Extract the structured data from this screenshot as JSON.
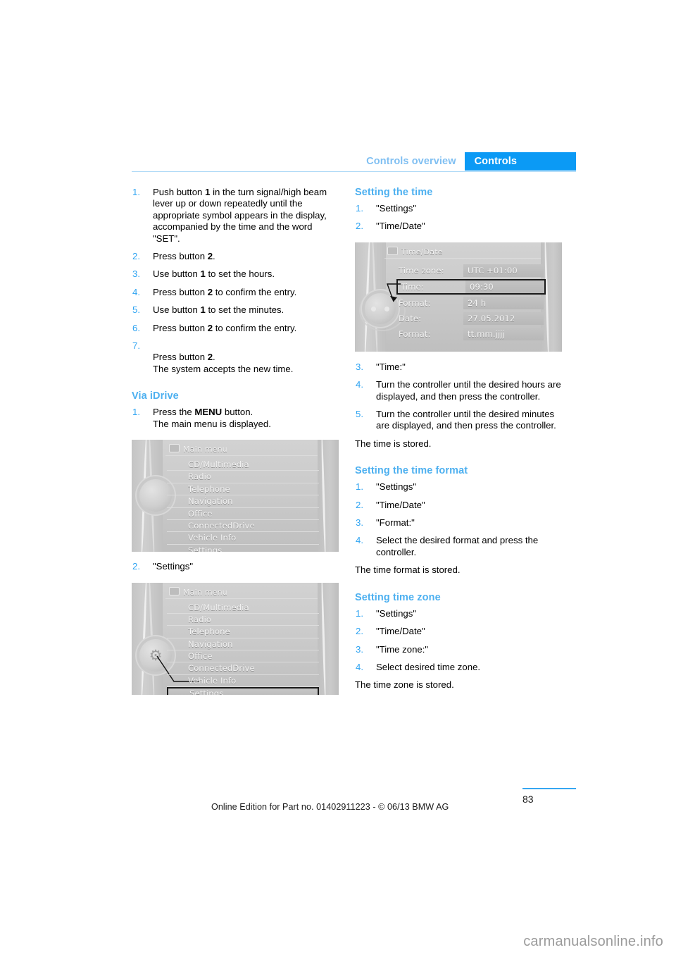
{
  "header": {
    "tab_inactive": "Controls overview",
    "tab_active": "Controls",
    "accent_color": "#0b9af5",
    "inactive_color": "#7fbff2"
  },
  "left_column": {
    "steps_top": [
      {
        "num": "1.",
        "text_pre": "Push button ",
        "bold": "1",
        "text_post": " in the turn signal/high beam lever up or down repeatedly until the appropriate symbol appears in the display, accompanied by the time and the word \"SET\"."
      },
      {
        "num": "2.",
        "text_pre": "Press button ",
        "bold": "2",
        "text_post": "."
      },
      {
        "num": "3.",
        "text_pre": "Use button ",
        "bold": "1",
        "text_post": " to set the hours."
      },
      {
        "num": "4.",
        "text_pre": "Press button ",
        "bold": "2",
        "text_post": " to confirm the entry."
      },
      {
        "num": "5.",
        "text_pre": "Use button ",
        "bold": "1",
        "text_post": " to set the minutes."
      },
      {
        "num": "6.",
        "text_pre": "Press button ",
        "bold": "2",
        "text_post": " to confirm the entry."
      },
      {
        "num": "7.",
        "text_pre": "Press button ",
        "bold": "2",
        "text_post": ".\nThe system accepts the new time."
      }
    ],
    "via_idrive_title": "Via iDrive",
    "step1_num": "1.",
    "step1_pre": "Press the ",
    "step1_bold": "MENU",
    "step1_post": " button.",
    "step1_line2": "The main menu is displayed.",
    "step2_num": "2.",
    "step2_text": "\"Settings\""
  },
  "idrive_main_menu": {
    "title": "Main menu",
    "items": [
      "CD/Multimedia",
      "Radio",
      "Telephone",
      "Navigation",
      "Office",
      "ConnectedDrive",
      "Vehicle Info",
      "Settings"
    ],
    "selected": "Settings"
  },
  "idrive_time_date": {
    "title": "Time/Date",
    "rows": [
      {
        "label": "Time zone:",
        "value": "UTC +01:00",
        "highlighted": false
      },
      {
        "label": "Time:",
        "value": "09:30",
        "highlighted": true
      },
      {
        "label": "Format:",
        "value": "24 h",
        "highlighted": false
      },
      {
        "label": "Date:",
        "value": "27.05.2012",
        "highlighted": false
      },
      {
        "label": "Format:",
        "value": "tt.mm.jjjj",
        "highlighted": false
      }
    ]
  },
  "right_column": {
    "setting_time": {
      "title": "Setting the time",
      "steps_before_image": [
        {
          "num": "1.",
          "text": "\"Settings\""
        },
        {
          "num": "2.",
          "text": "\"Time/Date\""
        }
      ],
      "steps_after_image": [
        {
          "num": "3.",
          "text": "\"Time:\""
        },
        {
          "num": "4.",
          "text": "Turn the controller until the desired hours are displayed, and then press the controller."
        },
        {
          "num": "5.",
          "text": "Turn the controller until the desired minutes are displayed, and then press the controller."
        }
      ],
      "result": "The time is stored."
    },
    "setting_time_format": {
      "title": "Setting the time format",
      "steps": [
        {
          "num": "1.",
          "text": "\"Settings\""
        },
        {
          "num": "2.",
          "text": "\"Time/Date\""
        },
        {
          "num": "3.",
          "text": "\"Format:\""
        },
        {
          "num": "4.",
          "text": "Select the desired format and press the controller."
        }
      ],
      "result": "The time format is stored."
    },
    "setting_time_zone": {
      "title": "Setting time zone",
      "steps": [
        {
          "num": "1.",
          "text": "\"Settings\""
        },
        {
          "num": "2.",
          "text": "\"Time/Date\""
        },
        {
          "num": "3.",
          "text": "\"Time zone:\""
        },
        {
          "num": "4.",
          "text": "Select desired time zone."
        }
      ],
      "result": "The time zone is stored."
    }
  },
  "footer": {
    "note": "Online Edition for Part no. 01402911223 - © 06/13 BMW AG",
    "page_number": "83",
    "watermark": "carmanualsonline.info"
  }
}
